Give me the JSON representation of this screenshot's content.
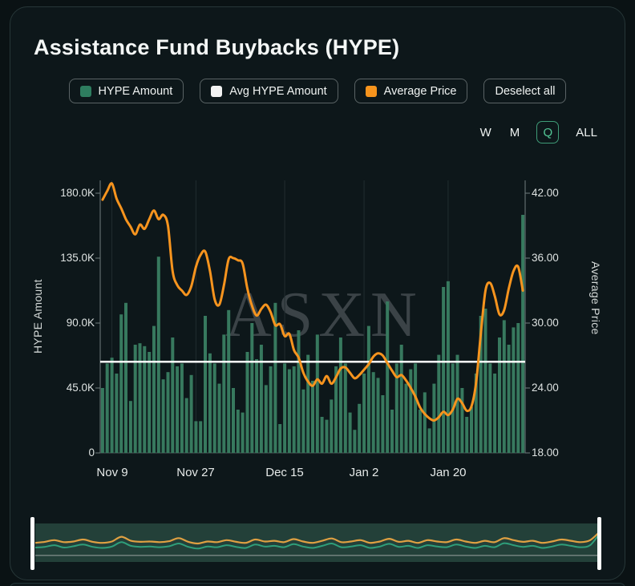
{
  "header": {
    "title": "Assistance Fund Buybacks (HYPE)"
  },
  "legend": {
    "items": [
      {
        "label": "HYPE Amount",
        "swatch_color": "#2e7d5f"
      },
      {
        "label": "Avg HYPE Amount",
        "swatch_color": "#f2f2f2"
      },
      {
        "label": "Average Price",
        "swatch_color": "#f7941d"
      }
    ],
    "deselect_label": "Deselect all"
  },
  "range_selector": {
    "options": [
      "W",
      "M",
      "Q",
      "ALL"
    ],
    "selected": "Q"
  },
  "watermark": "ASXN",
  "chart_data": {
    "type": "bar",
    "title": "Assistance Fund Buybacks (HYPE)",
    "grid": "vertical-only",
    "y_left": {
      "label": "HYPE Amount",
      "tick_labels": [
        "180.0K",
        "135.0K",
        "90.0K",
        "45.0K",
        "0"
      ],
      "tick_values": [
        180,
        135,
        90,
        45,
        0
      ],
      "range": [
        0,
        191
      ],
      "unit": "K"
    },
    "y_right": {
      "label": "Average Price",
      "tick_labels": [
        "42.00",
        "36.00",
        "30.00",
        "24.00",
        "18.00"
      ],
      "tick_values": [
        42,
        36,
        30,
        24,
        18
      ],
      "range": [
        18,
        43.2
      ]
    },
    "x_ticks": [
      {
        "label": "Nov 9",
        "index": 2
      },
      {
        "label": "Nov 27",
        "index": 20
      },
      {
        "label": "Dec 15",
        "index": 39
      },
      {
        "label": "Jan 2",
        "index": 56
      },
      {
        "label": "Jan 20",
        "index": 74
      }
    ],
    "series": [
      {
        "name": "HYPE Amount",
        "type": "bar",
        "axis": "left",
        "color": "#37795e",
        "unit": "K",
        "values": [
          45,
          62,
          66,
          55,
          96,
          104,
          36,
          75,
          76,
          74,
          70,
          88,
          136,
          51,
          56,
          80,
          60,
          62,
          38,
          54,
          22,
          22,
          95,
          69,
          62,
          48,
          82,
          99,
          45,
          30,
          28,
          70,
          90,
          65,
          75,
          47,
          60,
          104,
          20,
          62,
          58,
          60,
          85,
          44,
          68,
          50,
          82,
          25,
          23,
          37,
          60,
          80,
          62,
          28,
          16,
          34,
          55,
          88,
          56,
          52,
          40,
          105,
          30,
          62,
          75,
          48,
          58,
          62,
          30,
          42,
          17,
          48,
          68,
          115,
          119,
          62,
          68,
          45,
          25,
          32,
          55,
          95,
          100,
          62,
          55,
          80,
          92,
          75,
          87,
          90,
          165
        ]
      },
      {
        "name": "Avg HYPE Amount",
        "type": "hline",
        "axis": "left",
        "color": "#ffffff",
        "value": 63.2,
        "unit": "K"
      },
      {
        "name": "Average Price",
        "type": "line",
        "axis": "right",
        "color": "#f7941e",
        "values": [
          41.4,
          42.2,
          42.9,
          41.5,
          40.6,
          39.6,
          38.9,
          38.2,
          39.1,
          38.7,
          39.6,
          40.4,
          39.6,
          40.0,
          39.0,
          34.8,
          33.5,
          33.0,
          32.6,
          33.4,
          35.2,
          36.3,
          36.6,
          34.8,
          32.2,
          31.7,
          33.5,
          35.9,
          36.0,
          35.8,
          35.5,
          33.2,
          31.6,
          30.7,
          31.3,
          31.7,
          31.0,
          29.8,
          29.9,
          28.8,
          29.0,
          27.5,
          26.8,
          25.4,
          24.6,
          24.2,
          24.8,
          24.4,
          25.1,
          24.4,
          25.0,
          25.8,
          25.9,
          25.4,
          24.9,
          25.2,
          25.7,
          26.2,
          26.9,
          27.2,
          27.0,
          26.3,
          25.6,
          25.0,
          25.2,
          24.7,
          24.0,
          23.2,
          22.2,
          21.6,
          21.2,
          21.0,
          21.3,
          21.8,
          21.5,
          22.0,
          23.0,
          22.6,
          21.9,
          22.3,
          24.5,
          29.0,
          33.0,
          33.7,
          32.5,
          30.8,
          31.2,
          33.2,
          34.8,
          35.2,
          33.0
        ]
      }
    ],
    "navigator": {
      "band_color": "#234039",
      "orange_color": "#dfa042",
      "green_color": "#2f9e7a",
      "baseline": 0.17,
      "orange": [
        0.52,
        0.55,
        0.6,
        0.54,
        0.56,
        0.62,
        0.55,
        0.52,
        0.56,
        0.7,
        0.58,
        0.55,
        0.56,
        0.54,
        0.57,
        0.66,
        0.55,
        0.5,
        0.56,
        0.54,
        0.6,
        0.55,
        0.52,
        0.62,
        0.56,
        0.58,
        0.54,
        0.63,
        0.56,
        0.52,
        0.58,
        0.65,
        0.54,
        0.56,
        0.6,
        0.52,
        0.56,
        0.64,
        0.55,
        0.58,
        0.52,
        0.6,
        0.56,
        0.54,
        0.62,
        0.56,
        0.52,
        0.58,
        0.54,
        0.66,
        0.6,
        0.55,
        0.58,
        0.52,
        0.56,
        0.62,
        0.58,
        0.54,
        0.6,
        0.85
      ],
      "green": [
        0.38,
        0.4,
        0.45,
        0.38,
        0.42,
        0.47,
        0.4,
        0.37,
        0.41,
        0.54,
        0.43,
        0.4,
        0.41,
        0.39,
        0.42,
        0.5,
        0.4,
        0.35,
        0.41,
        0.39,
        0.45,
        0.4,
        0.37,
        0.47,
        0.41,
        0.43,
        0.39,
        0.48,
        0.41,
        0.37,
        0.43,
        0.5,
        0.39,
        0.41,
        0.45,
        0.37,
        0.41,
        0.49,
        0.4,
        0.43,
        0.37,
        0.45,
        0.41,
        0.39,
        0.47,
        0.41,
        0.37,
        0.43,
        0.39,
        0.51,
        0.45,
        0.4,
        0.43,
        0.37,
        0.41,
        0.47,
        0.43,
        0.39,
        0.45,
        0.8
      ]
    }
  }
}
